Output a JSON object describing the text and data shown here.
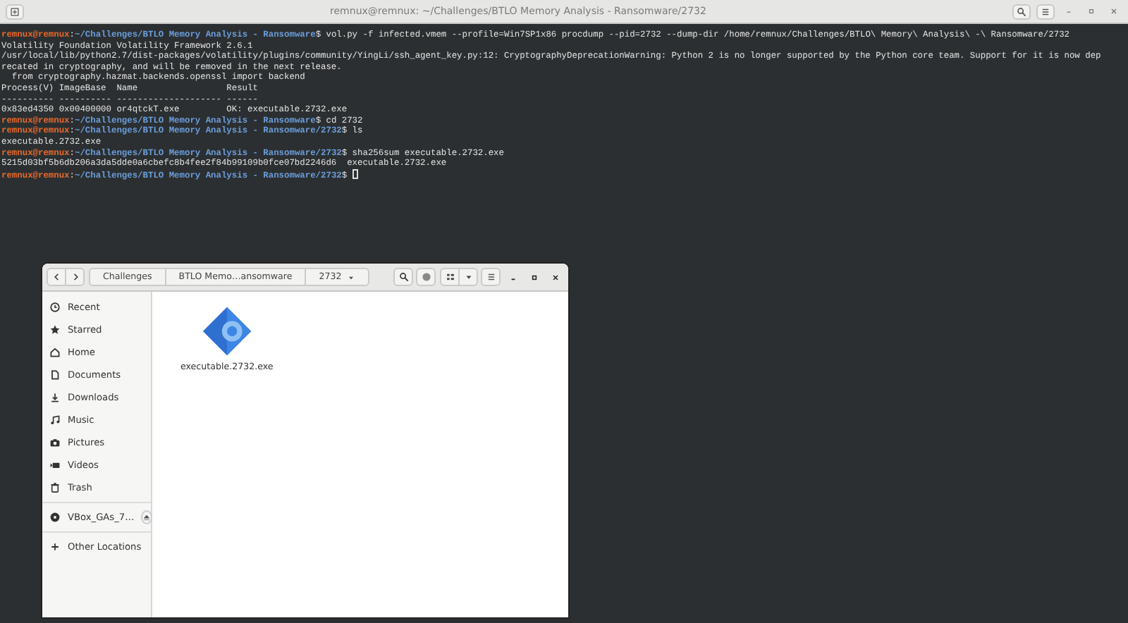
{
  "terminal": {
    "title": "remnux@remnux: ~/Challenges/BTLO Memory Analysis - Ransomware/2732",
    "lines": [
      {
        "kind": "prompt",
        "user": "remnux@remnux",
        "sep": ":",
        "path": "~/Challenges/BTLO Memory Analysis - Ransomware",
        "command": "$ vol.py -f infected.vmem --profile=Win7SP1x86 procdump --pid=2732 --dump-dir /home/remnux/Challenges/BTLO\\ Memory\\ Analysis\\ -\\ Ransomware/2732"
      },
      {
        "kind": "output",
        "text": "Volatility Foundation Volatility Framework 2.6.1"
      },
      {
        "kind": "output",
        "text": "/usr/local/lib/python2.7/dist-packages/volatility/plugins/community/YingLi/ssh_agent_key.py:12: CryptographyDeprecationWarning: Python 2 is no longer supported by the Python core team. Support for it is now dep"
      },
      {
        "kind": "output",
        "text": "recated in cryptography, and will be removed in the next release."
      },
      {
        "kind": "output",
        "text": "  from cryptography.hazmat.backends.openssl import backend"
      },
      {
        "kind": "output",
        "text": "Process(V) ImageBase  Name                 Result"
      },
      {
        "kind": "output",
        "text": "---------- ---------- -------------------- ------"
      },
      {
        "kind": "output",
        "text": "0x83ed4350 0x00400000 or4qtckT.exe         OK: executable.2732.exe"
      },
      {
        "kind": "prompt",
        "user": "remnux@remnux",
        "sep": ":",
        "path": "~/Challenges/BTLO Memory Analysis - Ransomware",
        "command": "$ cd 2732"
      },
      {
        "kind": "prompt",
        "user": "remnux@remnux",
        "sep": ":",
        "path": "~/Challenges/BTLO Memory Analysis - Ransomware/2732",
        "command": "$ ls"
      },
      {
        "kind": "output",
        "text": "executable.2732.exe"
      },
      {
        "kind": "prompt",
        "user": "remnux@remnux",
        "sep": ":",
        "path": "~/Challenges/BTLO Memory Analysis - Ransomware/2732",
        "command": "$ sha256sum executable.2732.exe"
      },
      {
        "kind": "output",
        "text": "5215d03bf5b6db206a3da5dde0a6cbefc8b4fee2f84b99109b0fce07bd2246d6  executable.2732.exe"
      },
      {
        "kind": "prompt",
        "user": "remnux@remnux",
        "sep": ":",
        "path": "~/Challenges/BTLO Memory Analysis - Ransomware/2732",
        "command": "$ ",
        "cursor": true
      }
    ]
  },
  "file_manager": {
    "path": [
      "Challenges",
      "BTLO Memo…ansomware",
      "2732"
    ],
    "sidebar": [
      {
        "kind": "place",
        "label": "Recent"
      },
      {
        "kind": "place",
        "label": "Starred"
      },
      {
        "kind": "place",
        "label": "Home"
      },
      {
        "kind": "place",
        "label": "Documents"
      },
      {
        "kind": "place",
        "label": "Downloads"
      },
      {
        "kind": "place",
        "label": "Music"
      },
      {
        "kind": "place",
        "label": "Pictures"
      },
      {
        "kind": "place",
        "label": "Videos"
      },
      {
        "kind": "place",
        "label": "Trash"
      },
      {
        "kind": "device",
        "label": "VBox_GAs_7…"
      },
      {
        "kind": "other",
        "label": "Other Locations"
      }
    ],
    "files": [
      {
        "name": "executable.2732.exe"
      }
    ]
  }
}
